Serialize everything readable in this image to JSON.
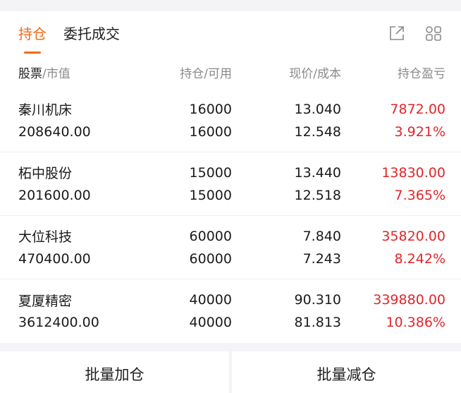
{
  "tabs": {
    "positions": "持仓",
    "orders": "委托成交"
  },
  "header": {
    "col1_a": "股票",
    "col1_b": "/市值",
    "col2": "持仓/可用",
    "col3": "现价/成本",
    "col4": "持仓盈亏"
  },
  "rows": [
    {
      "name": "秦川机床",
      "market_value": "208640.00",
      "hold": "16000",
      "avail": "16000",
      "price": "13.040",
      "cost": "12.548",
      "pnl": "7872.00",
      "pnl_pct": "3.921%"
    },
    {
      "name": "柘中股份",
      "market_value": "201600.00",
      "hold": "15000",
      "avail": "15000",
      "price": "13.440",
      "cost": "12.518",
      "pnl": "13830.00",
      "pnl_pct": "7.365%"
    },
    {
      "name": "大位科技",
      "market_value": "470400.00",
      "hold": "60000",
      "avail": "60000",
      "price": "7.840",
      "cost": "7.243",
      "pnl": "35820.00",
      "pnl_pct": "8.242%"
    },
    {
      "name": "夏厦精密",
      "market_value": "3612400.00",
      "hold": "40000",
      "avail": "40000",
      "price": "90.310",
      "cost": "81.813",
      "pnl": "339880.00",
      "pnl_pct": "10.386%"
    }
  ],
  "footer": {
    "batch_add": "批量加仓",
    "batch_reduce": "批量减仓"
  },
  "colors": {
    "accent": "#f26b1d",
    "profit": "#e0262a"
  },
  "icons": [
    "share-icon",
    "grid-icon"
  ]
}
